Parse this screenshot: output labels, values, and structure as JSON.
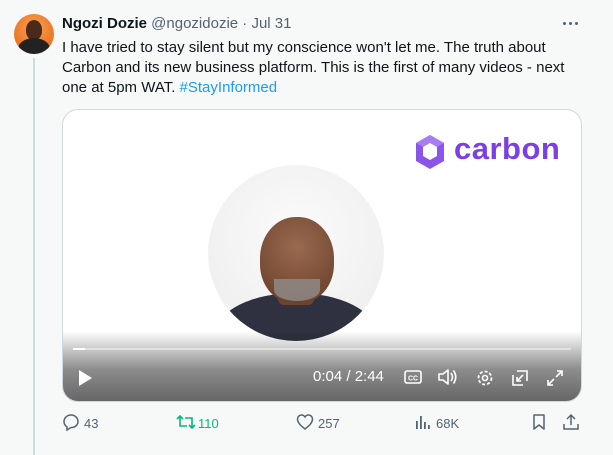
{
  "author": {
    "name": "Ngozi Dozie",
    "handle": "@ngozidozie",
    "separator": "·",
    "date": "Jul 31"
  },
  "tweet": {
    "text": "I have tried to stay silent but my conscience won't let me.  The truth about Carbon and its new business platform.  This is the first of many videos - next one at 5pm WAT. ",
    "hashtag": "#StayInformed"
  },
  "video": {
    "brand_logo_text": "carbon",
    "time_display": "0:04 / 2:44",
    "progress_fraction": 0.025,
    "accent_color": "#7b3fe4"
  },
  "actions": {
    "replies": "43",
    "retweets": "110",
    "likes": "257",
    "views": "68K"
  },
  "colors": {
    "link": "#1d9bf0",
    "retweet": "#00ba7c",
    "secondary": "#536471"
  }
}
